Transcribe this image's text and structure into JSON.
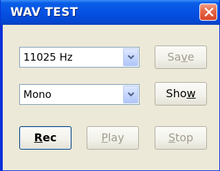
{
  "window": {
    "title": "WAV TEST",
    "close_icon": "close-icon"
  },
  "rate_combo": {
    "value": "11025 Hz",
    "arrow_icon": "chevron-down-icon"
  },
  "channel_combo": {
    "value": "Mono",
    "arrow_icon": "chevron-down-icon"
  },
  "buttons": {
    "save": {
      "pre": "Sa",
      "mnemonic": "v",
      "post": "e",
      "enabled": false
    },
    "show": {
      "pre": "Sho",
      "mnemonic": "w",
      "post": "",
      "enabled": true
    },
    "rec": {
      "pre": "",
      "mnemonic": "R",
      "post": "ec",
      "enabled": true
    },
    "play": {
      "pre": "",
      "mnemonic": "P",
      "post": "lay",
      "enabled": false
    },
    "stop": {
      "pre": "",
      "mnemonic": "S",
      "post": "top",
      "enabled": false
    }
  },
  "colors": {
    "titlebar": "#0551e3",
    "window_face": "#ece9d8",
    "close_button": "#d8462a",
    "disabled_text": "#a19e8f"
  }
}
